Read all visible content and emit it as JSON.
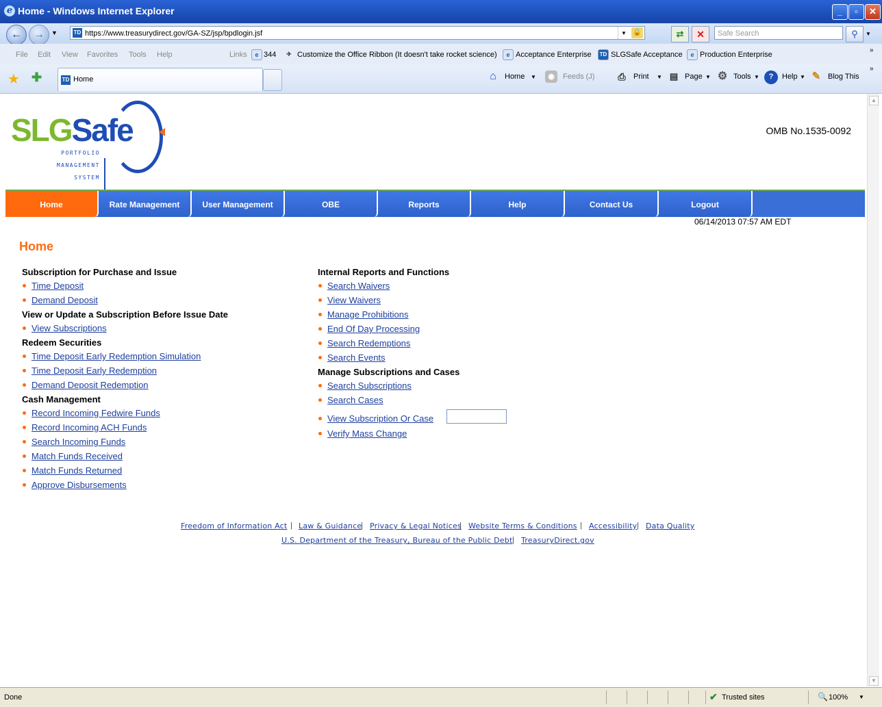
{
  "window": {
    "title": "Home - Windows Internet Explorer",
    "url": "https://www.treasurydirect.gov/GA-SZ/jsp/bpdlogin.jsf",
    "search_placeholder": "Safe Search"
  },
  "menubar": [
    "File",
    "Edit",
    "View",
    "Favorites",
    "Tools",
    "Help"
  ],
  "links_bar": {
    "label": "Links",
    "items": [
      "344",
      "Customize the Office Ribbon (It doesn't take rocket science)",
      "Acceptance Enterprise",
      "SLGSafe Acceptance",
      "Production Enterprise"
    ]
  },
  "tab": {
    "label": "Home",
    "favicon": "TD"
  },
  "command_bar": {
    "home": "Home",
    "feeds": "Feeds (J)",
    "print": "Print",
    "page": "Page",
    "tools": "Tools",
    "help": "Help",
    "blog": "Blog This"
  },
  "logo": {
    "slg": "SLG",
    "safe": "Safe",
    "line1": "PORTFOLIO",
    "line2": "MANAGEMENT",
    "line3": "SYSTEM"
  },
  "omb": "OMB No.1535-0092",
  "nav": [
    "Home",
    "Rate Management",
    "User Management",
    "OBE",
    "Reports",
    "Help",
    "Contact Us",
    "Logout"
  ],
  "datetime": "06/14/2013 07:57 AM EDT",
  "page_title": "Home",
  "left_column": {
    "sec1": "Subscription for Purchase and Issue",
    "sec1_links": [
      "Time Deposit",
      "Demand Deposit"
    ],
    "sec2": "View or Update a Subscription Before Issue Date",
    "sec2_links": [
      "View Subscriptions"
    ],
    "sec3": "Redeem Securities",
    "sec3_links": [
      "Time Deposit Early Redemption Simulation",
      "Time Deposit Early Redemption",
      "Demand Deposit Redemption"
    ],
    "sec4": "Cash Management",
    "sec4_links": [
      "Record Incoming Fedwire Funds",
      "Record Incoming ACH Funds",
      "Search Incoming Funds",
      "Match Funds Received",
      "Match Funds Returned",
      "Approve Disbursements"
    ]
  },
  "right_column": {
    "sec1": "Internal Reports and Functions",
    "sec1_links": [
      "Search Waivers",
      "View Waivers",
      "Manage Prohibitions",
      "End Of Day Processing",
      "Search Redemptions",
      "Search Events"
    ],
    "sec2": "Manage Subscriptions and Cases",
    "sec2_links": [
      "Search Subscriptions",
      "Search Cases",
      "View Subscription Or Case",
      "Verify Mass Change"
    ]
  },
  "footer": {
    "row1": [
      "Freedom of Information Act",
      "Law & Guidance",
      "Privacy & Legal Notices",
      "Website Terms & Conditions",
      "Accessibility",
      "Data Quality"
    ],
    "row2": [
      "U.S. Department of the Treasury, Bureau of the Public Debt",
      "TreasuryDirect.gov"
    ]
  },
  "statusbar": {
    "status": "Done",
    "zone": "Trusted sites",
    "zoom": "100%"
  },
  "colors": {
    "accent": "#ff6a0e",
    "nav_blue": "#3a6fd8",
    "link": "#1d3f9e"
  }
}
